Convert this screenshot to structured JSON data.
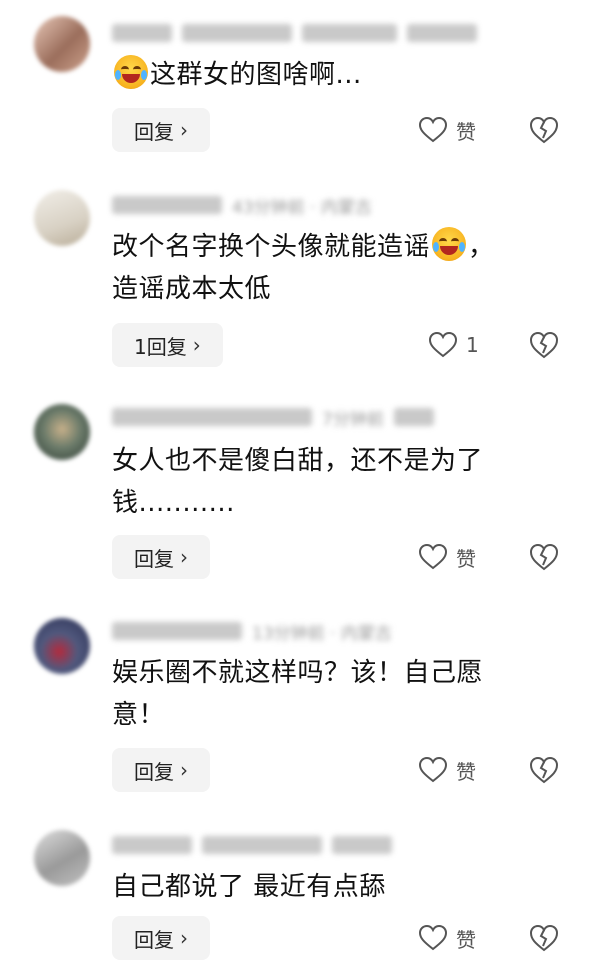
{
  "comments": [
    {
      "content": "这群女的图啥啊...",
      "reply_label": "回复",
      "like_label": "赞",
      "avatar_colors": [
        "#e8c8b8",
        "#9b6e5c",
        "#cfa38e"
      ]
    },
    {
      "meta": "43分钟前 · 内蒙古",
      "content_1": "改个名字换个头像就能造谣",
      "content_1_tail": "，",
      "content_2": "造谣成本太低",
      "reply_label": "1回复",
      "like_label": "1",
      "avatar_colors": [
        "#f1eee8",
        "#d8d1c4",
        "#b9ad98"
      ]
    },
    {
      "meta": "7分钟前",
      "content_1": "女人也不是傻白甜，还不是为了",
      "content_2": "钱...........",
      "reply_label": "回复",
      "like_label": "赞",
      "avatar_colors": [
        "#6b7b6a",
        "#2e3b33",
        "#c7b08a"
      ]
    },
    {
      "meta": "13分钟前 · 内蒙古",
      "content_1": "娱乐圈不就这样吗？该！自己愿",
      "content_2": "意！",
      "reply_label": "回复",
      "like_label": "赞",
      "avatar_colors": [
        "#2a2f52",
        "#b42a3c",
        "#51597e"
      ]
    },
    {
      "content": "自己都说了 最近有点舔",
      "reply_label": "回复",
      "like_label": "赞",
      "avatar_colors": [
        "#dedede",
        "#9a9a9a",
        "#c2c2c2"
      ]
    }
  ],
  "colors": {
    "reply_bg": "#f3f3f3",
    "text_primary": "#111111",
    "meta_gray": "#9a9a9a"
  },
  "icons": [
    "heart-outline-icon",
    "broken-heart-icon",
    "chevron-right-icon",
    "laughing-crying-emoji"
  ]
}
